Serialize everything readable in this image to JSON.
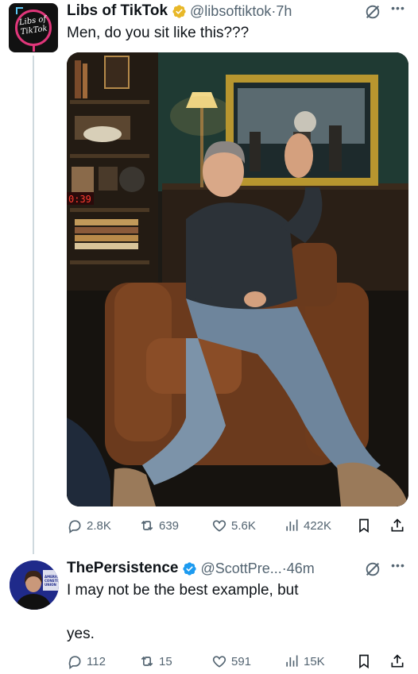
{
  "tweet1": {
    "avatar_logo_line1": "Libs of",
    "avatar_logo_line2": "TikTok",
    "display_name": "Libs of TikTok",
    "handle": "@libsoftiktok",
    "separator": "·",
    "time": "7h",
    "text": "Men, do you sit like this???",
    "media_overlay_text": "0:39",
    "stats": {
      "replies": "2.8K",
      "reposts": "639",
      "likes": "5.6K",
      "views": "422K"
    }
  },
  "tweet2": {
    "display_name": "ThePersistence",
    "handle": "@ScottPre...",
    "separator": "·",
    "time": "46m",
    "text_line1": "I may not be the best example, but",
    "text_line2": "yes.",
    "avatar_lettering": "AMERICAN CONSTITUTION UNION",
    "stats": {
      "replies": "112",
      "reposts": "15",
      "likes": "591",
      "views": "15K"
    }
  },
  "colors": {
    "verified_gold": "#e8b829",
    "icon_gray": "#536471",
    "thread_line": "#cfd9de",
    "brand_pink": "#e0367a",
    "brand_blue": "#5bc8f5"
  },
  "icons": [
    "grok-icon",
    "more-icon",
    "reply-icon",
    "repost-icon",
    "like-icon",
    "views-icon",
    "bookmark-icon",
    "share-icon",
    "verified-badge-icon"
  ]
}
